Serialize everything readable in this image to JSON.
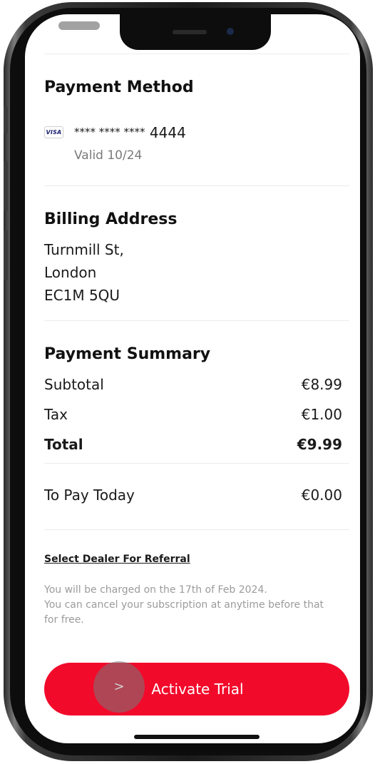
{
  "payment_method": {
    "title": "Payment Method",
    "card_brand": "VISA",
    "card_mask": "**** **** ****",
    "card_last4": "4444",
    "valid_label": "Valid 10/24"
  },
  "billing_address": {
    "title": "Billing Address",
    "lines": [
      "Turnmill St,",
      "London",
      "EC1M 5QU"
    ]
  },
  "payment_summary": {
    "title": "Payment Summary",
    "rows": [
      {
        "label": "Subtotal",
        "value": "€8.99"
      },
      {
        "label": "Tax",
        "value": "€1.00"
      },
      {
        "label": "Total",
        "value": "€9.99"
      }
    ],
    "to_pay": {
      "label": "To Pay Today",
      "value": "€0.00"
    }
  },
  "referral": {
    "link_label": "Select Dealer For Referral"
  },
  "notice": {
    "lines": [
      "You will be charged on the 17th of Feb 2024.",
      "You can cancel your subscription at anytime before that",
      "for free."
    ]
  },
  "cta": {
    "label": "Activate Trial",
    "touch_glyph": ">"
  },
  "colors": {
    "accent": "#f20a2b",
    "muted_text": "#9b9b9b"
  }
}
